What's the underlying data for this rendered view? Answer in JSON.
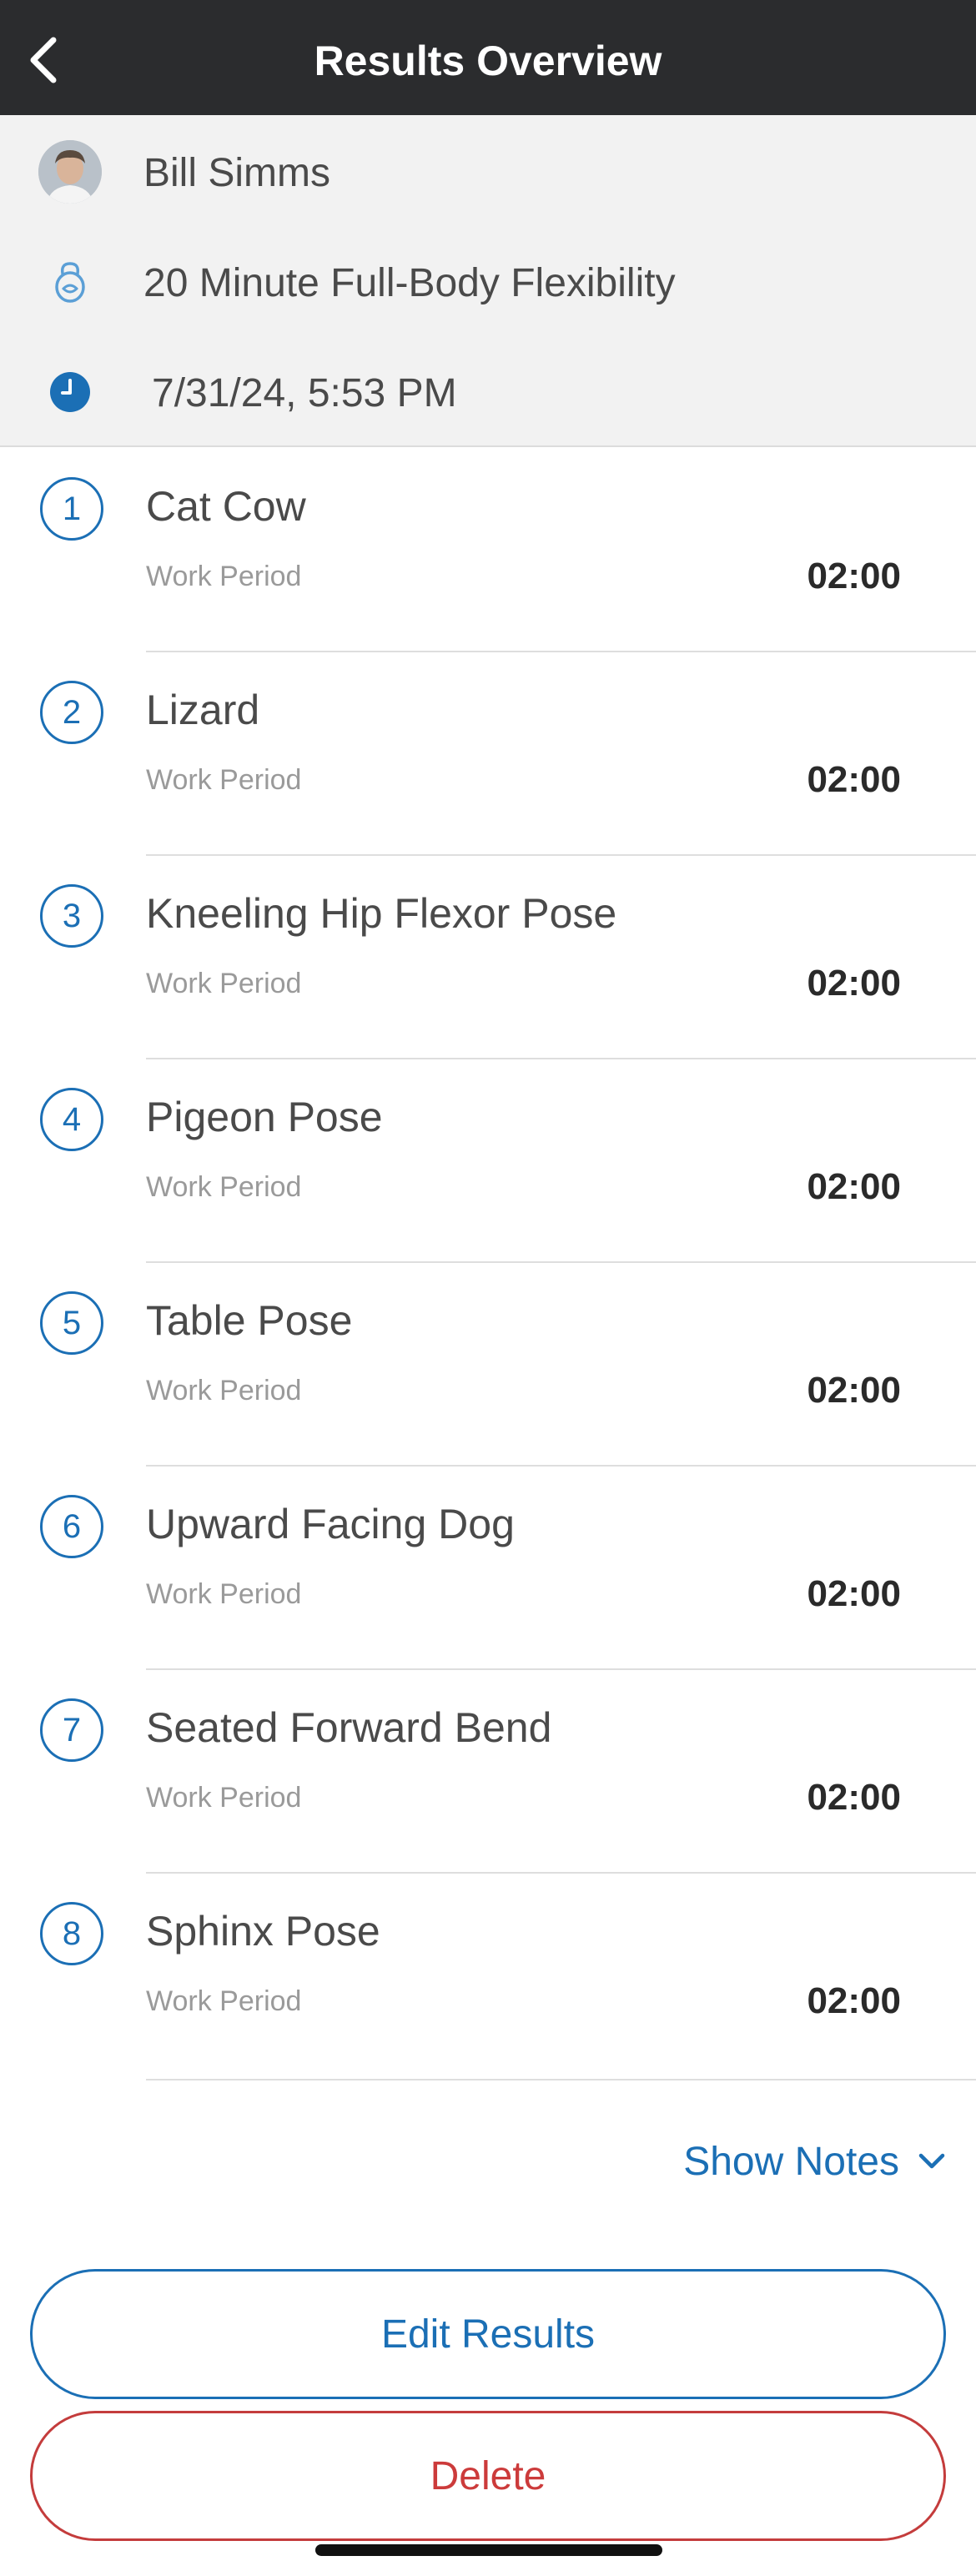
{
  "navbar": {
    "title": "Results Overview"
  },
  "header": {
    "athlete_name": "Bill Simms",
    "workout_name": "20 Minute Full-Body Flexibility",
    "date_time": "7/31/24, 5:53 PM"
  },
  "exercises": [
    {
      "number": "1",
      "name": "Cat Cow",
      "period": "Work Period",
      "time": "02:00"
    },
    {
      "number": "2",
      "name": "Lizard",
      "period": "Work Period",
      "time": "02:00"
    },
    {
      "number": "3",
      "name": "Kneeling Hip Flexor Pose",
      "period": "Work Period",
      "time": "02:00"
    },
    {
      "number": "4",
      "name": "Pigeon Pose",
      "period": "Work Period",
      "time": "02:00"
    },
    {
      "number": "5",
      "name": "Table Pose",
      "period": "Work Period",
      "time": "02:00"
    },
    {
      "number": "6",
      "name": "Upward Facing Dog",
      "period": "Work Period",
      "time": "02:00"
    },
    {
      "number": "7",
      "name": "Seated Forward Bend",
      "period": "Work Period",
      "time": "02:00"
    },
    {
      "number": "8",
      "name": "Sphinx Pose",
      "period": "Work Period",
      "time": "02:00"
    }
  ],
  "notes": {
    "toggle_label": "Show Notes"
  },
  "actions": {
    "edit_label": "Edit Results",
    "delete_label": "Delete"
  },
  "icons": {
    "back": "chevron-left-icon",
    "avatar": "avatar",
    "workout": "kettlebell-icon",
    "date": "clock-icon",
    "notes": "chevron-down-icon"
  },
  "colors": {
    "navbar_bg": "#2b2c2e",
    "accent_blue": "#1b6fb5",
    "delete_red": "#cc3b3b",
    "header_bg": "#f2f2f2"
  }
}
